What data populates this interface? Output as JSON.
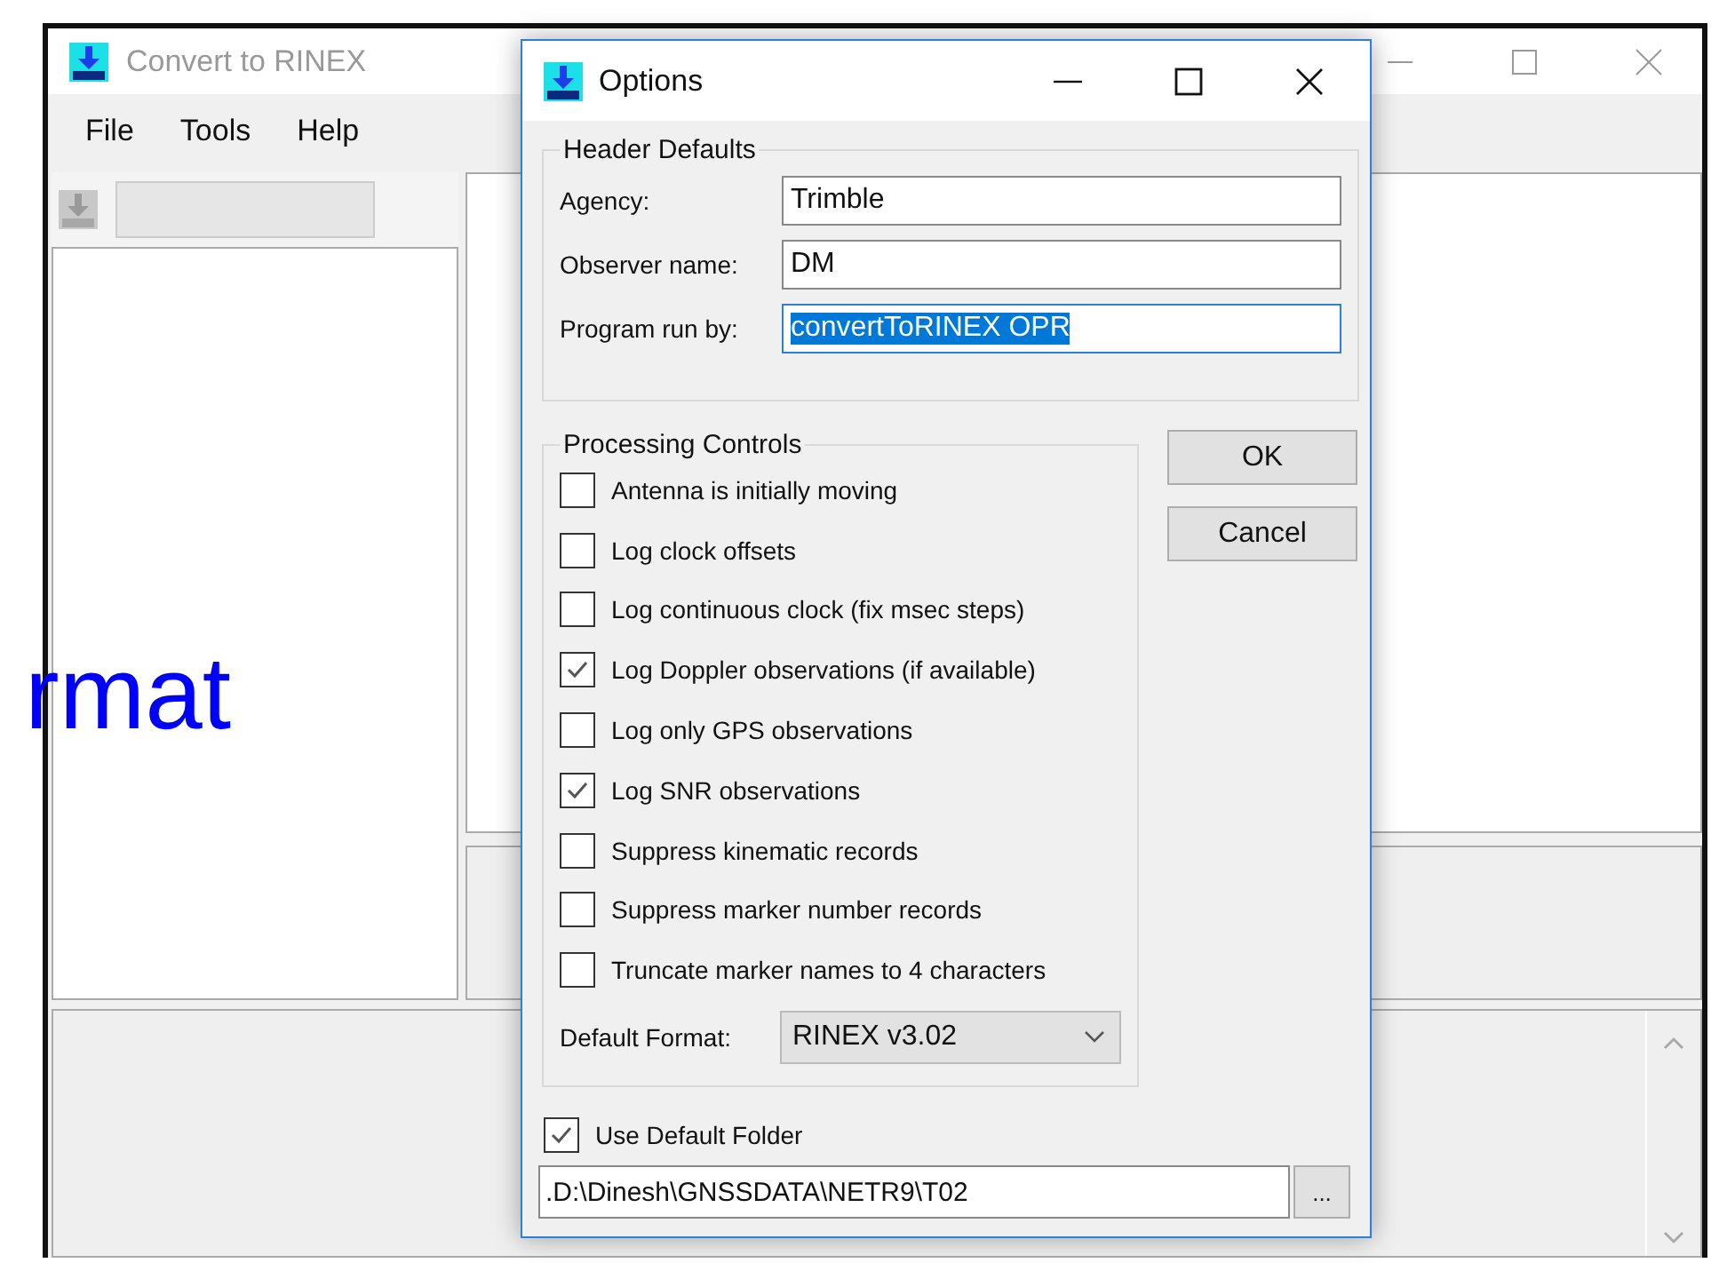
{
  "slide_text": "rmat",
  "main_window": {
    "title": "Convert to RINEX",
    "menu": [
      "File",
      "Tools",
      "Help"
    ]
  },
  "dialog": {
    "title": "Options",
    "header_defaults": {
      "title": "Header Defaults",
      "fields": [
        {
          "label": "Agency:",
          "value": "Trimble",
          "selected": false
        },
        {
          "label": "Observer name:",
          "value": "DM",
          "selected": false
        },
        {
          "label": "Program run by:",
          "value": "convertToRINEX OPR",
          "selected": true
        }
      ]
    },
    "processing_controls": {
      "title": "Processing Controls",
      "options": [
        {
          "label": "Antenna is initially moving",
          "checked": false
        },
        {
          "label": "Log clock offsets",
          "checked": false
        },
        {
          "label": "Log continuous clock (fix msec steps)",
          "checked": false
        },
        {
          "label": "Log Doppler observations (if available)",
          "checked": true
        },
        {
          "label": "Log only GPS observations",
          "checked": false
        },
        {
          "label": "Log SNR observations",
          "checked": true
        },
        {
          "label": "Suppress kinematic records",
          "checked": false
        },
        {
          "label": "Suppress marker number records",
          "checked": false
        },
        {
          "label": "Truncate marker names to 4 characters",
          "checked": false
        }
      ],
      "format_label": "Default Format:",
      "format_value": "RINEX v3.02"
    },
    "buttons": [
      "OK",
      "Cancel"
    ],
    "use_default_folder": {
      "label": "Use Default Folder",
      "checked": true
    },
    "folder_path": ".D:\\Dinesh\\GNSSDATA\\NETR9\\T02",
    "browse_button": "..."
  }
}
